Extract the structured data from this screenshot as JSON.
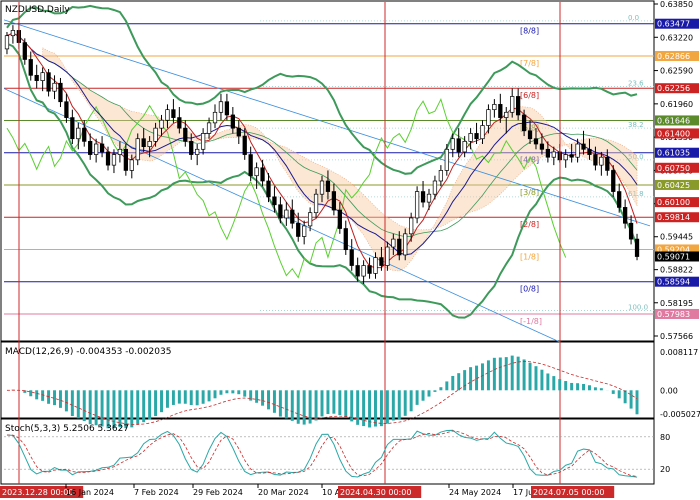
{
  "symbol_title": "NZDUSD,Daily",
  "macd_label": "MACD(12,26,9) -0.004353 -0.002035",
  "stoch_label": "Stoch(5,3,3) 5.2506 5.3627",
  "chart_data": [
    {
      "type": "candlestick",
      "title": "NZDUSD,Daily",
      "y_range": [
        0.57566,
        0.6385
      ],
      "price_ticks": [
        "0.63850",
        "0.63220",
        "0.62590",
        "0.61960",
        "0.61330",
        "0.60700",
        "0.60070",
        "0.59445",
        "0.58822",
        "0.58195",
        "0.57566"
      ],
      "highlighted_prices": [
        {
          "label": "0.63477",
          "value": 0.63477,
          "color": "#1a1aa8"
        },
        {
          "label": "0.62866",
          "value": 0.62866,
          "color": "#f2a640"
        },
        {
          "label": "0.62256",
          "value": 0.62256,
          "color": "#cc2222"
        },
        {
          "label": "0.61646",
          "value": 0.61646,
          "color": "#5a8a2a"
        },
        {
          "label": "0.61400",
          "value": 0.614,
          "color": "#cc2222"
        },
        {
          "label": "0.61035",
          "value": 0.61035,
          "color": "#1a1aa8"
        },
        {
          "label": "0.60750",
          "value": 0.6075,
          "color": "#cc2222"
        },
        {
          "label": "0.60425",
          "value": 0.60425,
          "color": "#8a9a2a"
        },
        {
          "label": "0.60100",
          "value": 0.601,
          "color": "#cc2222"
        },
        {
          "label": "0.59814",
          "value": 0.59814,
          "color": "#cc2222"
        },
        {
          "label": "0.59204",
          "value": 0.59204,
          "color": "#f2a640"
        },
        {
          "label": "0.59071",
          "value": 0.59071,
          "color": "#000000"
        },
        {
          "label": "0.58594",
          "value": 0.58594,
          "color": "#1a1aa8"
        },
        {
          "label": "0.57983",
          "value": 0.57983,
          "color": "#e07aa0"
        }
      ],
      "murrey_levels": [
        {
          "label": "[8/8]",
          "value": 0.63477,
          "color": "#1a1aa8"
        },
        {
          "label": "[7/8]",
          "value": 0.62866,
          "color": "#f2a640"
        },
        {
          "label": "[6/8]",
          "value": 0.62256,
          "color": "#cc2222"
        },
        {
          "label": "[5/8]",
          "value": 0.61646,
          "color": "#5a8a2a"
        },
        {
          "label": "[4/8]",
          "value": 0.61035,
          "color": "#1a1aa8"
        },
        {
          "label": "[3/8]",
          "value": 0.60425,
          "color": "#8a9a2a"
        },
        {
          "label": "[2/8]",
          "value": 0.59814,
          "color": "#cc2222"
        },
        {
          "label": "[1/8]",
          "value": 0.59204,
          "color": "#f2a640"
        },
        {
          "label": "[0/8]",
          "value": 0.58594,
          "color": "#1a1aa8"
        },
        {
          "label": "[-1/8]",
          "value": 0.57983,
          "color": "#e07aa0"
        }
      ],
      "fib_levels": [
        {
          "label": "0.0",
          "value": 0.6353
        },
        {
          "label": "23.6",
          "value": 0.6229
        },
        {
          "label": "38.2",
          "value": 0.615
        },
        {
          "label": "50.0",
          "value": 0.609
        },
        {
          "label": "61.8",
          "value": 0.602
        },
        {
          "label": "100.0",
          "value": 0.5805
        }
      ],
      "x_labels": [
        "2023.12.28 00:00",
        "16 Jan 2024",
        "7 Feb 2024",
        "29 Feb 2024",
        "20 Mar 2024",
        "10 Apr 2024",
        "2024.04.30 00:00",
        "24 May 2024",
        "17 Jun 2024",
        "2024.07.05 00:00"
      ],
      "ohlc": [
        [
          0.63,
          0.6332,
          0.629,
          0.6325
        ],
        [
          0.6325,
          0.6345,
          0.631,
          0.6335
        ],
        [
          0.6335,
          0.635,
          0.63,
          0.6312
        ],
        [
          0.6312,
          0.632,
          0.627,
          0.628
        ],
        [
          0.628,
          0.6295,
          0.624,
          0.625
        ],
        [
          0.625,
          0.627,
          0.6225,
          0.624
        ],
        [
          0.624,
          0.6265,
          0.622,
          0.6255
        ],
        [
          0.6255,
          0.6262,
          0.621,
          0.622
        ],
        [
          0.622,
          0.625,
          0.6205,
          0.6235
        ],
        [
          0.6235,
          0.6245,
          0.619,
          0.62
        ],
        [
          0.62,
          0.6215,
          0.616,
          0.617
        ],
        [
          0.617,
          0.6185,
          0.612,
          0.613
        ],
        [
          0.613,
          0.616,
          0.611,
          0.615
        ],
        [
          0.615,
          0.6165,
          0.6115,
          0.6125
        ],
        [
          0.6125,
          0.614,
          0.609,
          0.61
        ],
        [
          0.61,
          0.613,
          0.6085,
          0.612
        ],
        [
          0.612,
          0.6135,
          0.6095,
          0.6105
        ],
        [
          0.6105,
          0.6115,
          0.607,
          0.608
        ],
        [
          0.608,
          0.611,
          0.6065,
          0.61
        ],
        [
          0.61,
          0.6125,
          0.6085,
          0.611
        ],
        [
          0.611,
          0.612,
          0.606,
          0.607
        ],
        [
          0.607,
          0.61,
          0.6055,
          0.609
        ],
        [
          0.609,
          0.614,
          0.608,
          0.613
        ],
        [
          0.613,
          0.615,
          0.6105,
          0.6115
        ],
        [
          0.6115,
          0.6135,
          0.6095,
          0.6125
        ],
        [
          0.6125,
          0.616,
          0.6115,
          0.615
        ],
        [
          0.615,
          0.6175,
          0.6135,
          0.6165
        ],
        [
          0.6165,
          0.6195,
          0.615,
          0.6185
        ],
        [
          0.6185,
          0.6205,
          0.616,
          0.617
        ],
        [
          0.617,
          0.619,
          0.614,
          0.615
        ],
        [
          0.615,
          0.6165,
          0.6115,
          0.6125
        ],
        [
          0.6125,
          0.614,
          0.609,
          0.61
        ],
        [
          0.61,
          0.612,
          0.608,
          0.611
        ],
        [
          0.611,
          0.615,
          0.61,
          0.614
        ],
        [
          0.614,
          0.617,
          0.613,
          0.616
        ],
        [
          0.616,
          0.6195,
          0.615,
          0.618
        ],
        [
          0.618,
          0.6215,
          0.6165,
          0.62
        ],
        [
          0.62,
          0.6215,
          0.6165,
          0.6175
        ],
        [
          0.6175,
          0.619,
          0.614,
          0.615
        ],
        [
          0.615,
          0.6165,
          0.612,
          0.6135
        ],
        [
          0.6135,
          0.615,
          0.609,
          0.61
        ],
        [
          0.61,
          0.6115,
          0.605,
          0.606
        ],
        [
          0.606,
          0.6085,
          0.6035,
          0.6075
        ],
        [
          0.6075,
          0.609,
          0.604,
          0.605
        ],
        [
          0.605,
          0.6065,
          0.601,
          0.602
        ],
        [
          0.602,
          0.604,
          0.599,
          0.6005
        ],
        [
          0.6005,
          0.602,
          0.597,
          0.598
        ],
        [
          0.598,
          0.601,
          0.5965,
          0.5995
        ],
        [
          0.5995,
          0.6015,
          0.596,
          0.597
        ],
        [
          0.597,
          0.599,
          0.5935,
          0.5945
        ],
        [
          0.5945,
          0.5975,
          0.593,
          0.5965
        ],
        [
          0.5965,
          0.6,
          0.5955,
          0.599
        ],
        [
          0.599,
          0.6035,
          0.598,
          0.6025
        ],
        [
          0.6025,
          0.606,
          0.601,
          0.605
        ],
        [
          0.605,
          0.607,
          0.6015,
          0.603
        ],
        [
          0.603,
          0.6045,
          0.5985,
          0.5995
        ],
        [
          0.5995,
          0.601,
          0.595,
          0.596
        ],
        [
          0.596,
          0.5975,
          0.591,
          0.592
        ],
        [
          0.592,
          0.594,
          0.588,
          0.589
        ],
        [
          0.589,
          0.5905,
          0.586,
          0.587
        ],
        [
          0.587,
          0.59,
          0.5855,
          0.589
        ],
        [
          0.589,
          0.5905,
          0.5865,
          0.5875
        ],
        [
          0.5875,
          0.5915,
          0.5865,
          0.5905
        ],
        [
          0.5905,
          0.5925,
          0.588,
          0.589
        ],
        [
          0.589,
          0.5935,
          0.588,
          0.5925
        ],
        [
          0.5925,
          0.595,
          0.591,
          0.594
        ],
        [
          0.594,
          0.5955,
          0.59,
          0.591
        ],
        [
          0.591,
          0.596,
          0.59,
          0.595
        ],
        [
          0.595,
          0.599,
          0.5935,
          0.598
        ],
        [
          0.598,
          0.604,
          0.597,
          0.603
        ],
        [
          0.603,
          0.605,
          0.6,
          0.601
        ],
        [
          0.601,
          0.6035,
          0.5995,
          0.6025
        ],
        [
          0.6025,
          0.606,
          0.6015,
          0.605
        ],
        [
          0.605,
          0.608,
          0.604,
          0.607
        ],
        [
          0.607,
          0.612,
          0.606,
          0.611
        ],
        [
          0.611,
          0.614,
          0.6095,
          0.613
        ],
        [
          0.613,
          0.615,
          0.6095,
          0.6105
        ],
        [
          0.6105,
          0.6135,
          0.6095,
          0.6125
        ],
        [
          0.6125,
          0.615,
          0.611,
          0.614
        ],
        [
          0.614,
          0.616,
          0.612,
          0.613
        ],
        [
          0.613,
          0.6165,
          0.612,
          0.6155
        ],
        [
          0.6155,
          0.6195,
          0.614,
          0.6185
        ],
        [
          0.6185,
          0.6205,
          0.617,
          0.6195
        ],
        [
          0.6195,
          0.6215,
          0.616,
          0.617
        ],
        [
          0.617,
          0.619,
          0.614,
          0.618
        ],
        [
          0.618,
          0.6225,
          0.617,
          0.621
        ],
        [
          0.621,
          0.6225,
          0.6165,
          0.6175
        ],
        [
          0.6175,
          0.6185,
          0.6135,
          0.6145
        ],
        [
          0.6145,
          0.6165,
          0.612,
          0.613
        ],
        [
          0.613,
          0.615,
          0.611,
          0.612
        ],
        [
          0.612,
          0.614,
          0.61,
          0.611
        ],
        [
          0.611,
          0.6125,
          0.6085,
          0.6095
        ],
        [
          0.6095,
          0.6115,
          0.608,
          0.6105
        ],
        [
          0.6105,
          0.612,
          0.6085,
          0.609
        ],
        [
          0.609,
          0.611,
          0.6075,
          0.61
        ],
        [
          0.61,
          0.612,
          0.6085,
          0.6095
        ],
        [
          0.6095,
          0.613,
          0.6085,
          0.612
        ],
        [
          0.612,
          0.6145,
          0.61,
          0.611
        ],
        [
          0.611,
          0.613,
          0.609,
          0.61
        ],
        [
          0.61,
          0.6115,
          0.607,
          0.608
        ],
        [
          0.608,
          0.6105,
          0.606,
          0.6095
        ],
        [
          0.6095,
          0.611,
          0.606,
          0.607
        ],
        [
          0.607,
          0.608,
          0.602,
          0.603
        ],
        [
          0.603,
          0.6045,
          0.599,
          0.6
        ],
        [
          0.6,
          0.6015,
          0.596,
          0.597
        ],
        [
          0.597,
          0.5985,
          0.593,
          0.594
        ],
        [
          0.594,
          0.595,
          0.59,
          0.5907
        ]
      ]
    },
    {
      "type": "bar",
      "title": "MACD(12,26,9) -0.004353 -0.002035",
      "y_range": [
        -0.005027,
        0.008117
      ],
      "ticks": [
        "0.008117",
        "0.00",
        "-0.005027"
      ]
    },
    {
      "type": "line",
      "title": "Stoch(5,3,3) 5.2506 5.3627",
      "y_range": [
        0,
        100
      ],
      "ticks": [
        "80",
        "20"
      ]
    }
  ]
}
